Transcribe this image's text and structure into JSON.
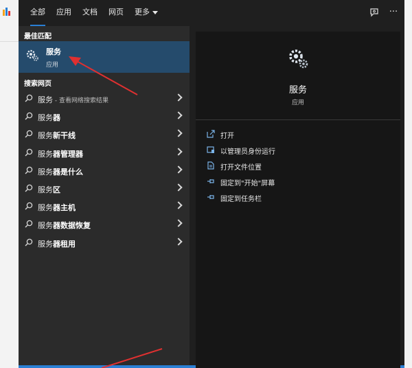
{
  "tabs": [
    {
      "label": "全部",
      "active": true
    },
    {
      "label": "应用"
    },
    {
      "label": "文档"
    },
    {
      "label": "网页"
    },
    {
      "label": "更多"
    }
  ],
  "top_icons": [
    "feedback-icon",
    "more-options-icon"
  ],
  "more_icon_text": "···",
  "best_match": {
    "section_label": "最佳匹配",
    "name": "服务",
    "type": "应用",
    "icon": "gear-icon"
  },
  "web_search": {
    "section_label": "搜索网页",
    "results": [
      {
        "prefix": "服务",
        "bold": "",
        "suffix": " - 查看网络搜索结果"
      },
      {
        "prefix": "服务",
        "bold": "器",
        "suffix": ""
      },
      {
        "prefix": "服务",
        "bold": "新干线",
        "suffix": ""
      },
      {
        "prefix": "服务",
        "bold": "器管理器",
        "suffix": ""
      },
      {
        "prefix": "服务",
        "bold": "器是什么",
        "suffix": ""
      },
      {
        "prefix": "服务",
        "bold": "区",
        "suffix": ""
      },
      {
        "prefix": "服务",
        "bold": "器主机",
        "suffix": ""
      },
      {
        "prefix": "服务",
        "bold": "器数据恢复",
        "suffix": ""
      },
      {
        "prefix": "服务",
        "bold": "器租用",
        "suffix": ""
      }
    ]
  },
  "detail": {
    "title": "服务",
    "type": "应用",
    "actions": [
      {
        "label": "打开",
        "icon": "open-icon"
      },
      {
        "label": "以管理员身份运行",
        "icon": "run-as-admin-icon"
      },
      {
        "label": "打开文件位置",
        "icon": "file-location-icon"
      },
      {
        "label": "固定到\"开始\"屏幕",
        "icon": "pin-icon"
      },
      {
        "label": "固定到任务栏",
        "icon": "pin-icon"
      }
    ]
  },
  "colors": {
    "accent": "#2a7fd4",
    "selected_bg": "#254b6c",
    "annotation": "#e03030"
  }
}
